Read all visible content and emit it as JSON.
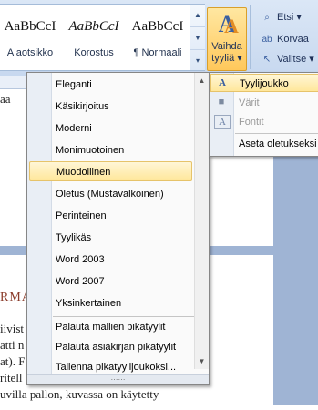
{
  "ribbon": {
    "styles": [
      {
        "preview": "AaBbCcI",
        "caption": "Alaotsikko",
        "italic": false
      },
      {
        "preview": "AaBbCcI",
        "caption": "Korostus",
        "italic": true
      },
      {
        "preview": "AaBbCcI",
        "caption": "¶ Normaali",
        "italic": false
      }
    ],
    "change_styles": {
      "line1": "Vaihda",
      "line2": "tyyliä",
      "arrow": "▾"
    },
    "editing": {
      "find": "Etsi",
      "find_arrow": "▾",
      "replace": "Korvaa",
      "select": "Valitse",
      "select_arrow": "▾"
    }
  },
  "document": {
    "fragments": [
      "aa",
      "RMA",
      "iivist",
      "atti n",
      "at). F",
      "ritell",
      "uvilla pallon, kuvassa on käytetty"
    ]
  },
  "menu": {
    "items": [
      "Eleganti",
      "Käsikirjoitus",
      "Moderni",
      "Monimuotoinen",
      "Muodollinen",
      "Oletus (Mustavalkoinen)",
      "Perinteinen",
      "Tyylikäs",
      "Word 2003",
      "Word 2007",
      "Yksinkertainen"
    ],
    "selected": "Muodollinen",
    "actions": [
      "Palauta mallien pikatyylit",
      "Palauta asiakirjan pikatyylit",
      "Tallenna pikatyylijoukoksi..."
    ],
    "grip": "⋯⋯"
  },
  "submenu": {
    "items": [
      {
        "label": "Tyylijoukko",
        "icon": "A",
        "disabled": false,
        "selected": true
      },
      {
        "label": "Värit",
        "icon": "■",
        "disabled": true,
        "selected": false
      },
      {
        "label": "Fontit",
        "icon": "A",
        "disabled": true,
        "selected": false
      },
      {
        "label": "Aseta oletukseksi",
        "icon": "",
        "disabled": false,
        "selected": false
      }
    ]
  },
  "colors": {
    "accent": "#ffe79b",
    "ribbon": "#c7d8ef",
    "doc_bg": "#9fb4d4"
  }
}
